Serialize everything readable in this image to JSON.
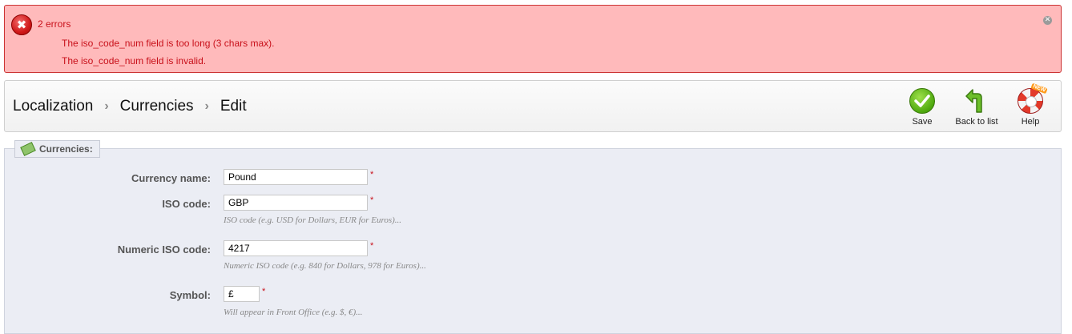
{
  "errors": {
    "title": "2 errors",
    "messages": [
      "The iso_code_num field is too long (3 chars max).",
      "The iso_code_num field is invalid."
    ]
  },
  "breadcrumb": [
    "Localization",
    "Currencies",
    "Edit"
  ],
  "toolbar": {
    "save_label": "Save",
    "back_label": "Back to list",
    "help_label": "Help",
    "help_badge": "NEW"
  },
  "form": {
    "legend": "Currencies:",
    "currency_name": {
      "label": "Currency name:",
      "value": "Pound"
    },
    "iso_code": {
      "label": "ISO code:",
      "value": "GBP",
      "hint": "ISO code (e.g. USD for Dollars, EUR for Euros)..."
    },
    "numeric_iso": {
      "label": "Numeric ISO code:",
      "value": "4217",
      "hint": "Numeric ISO code (e.g. 840 for Dollars, 978 for Euros)..."
    },
    "symbol": {
      "label": "Symbol:",
      "value": "£",
      "hint": "Will appear in Front Office (e.g. $, €)..."
    },
    "required_mark": "*"
  }
}
